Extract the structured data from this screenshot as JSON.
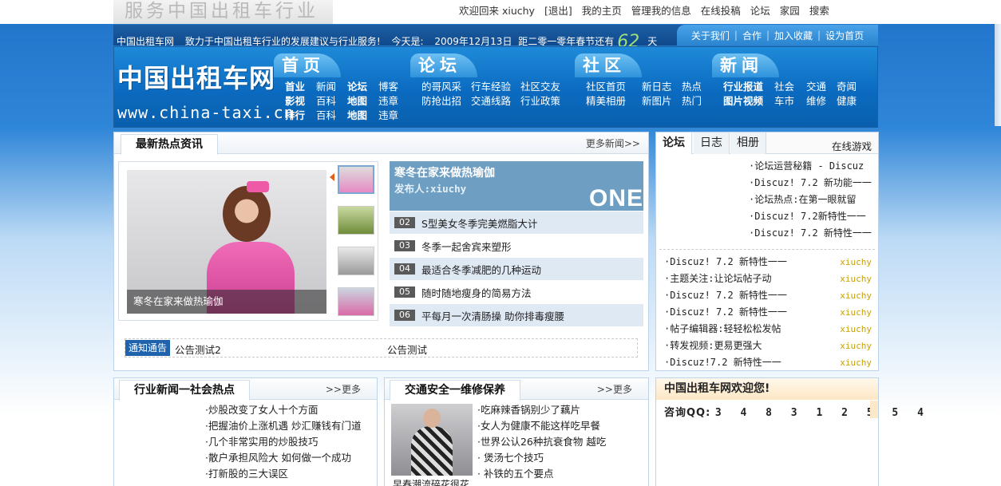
{
  "top": {
    "slogan": "服务中国出租车行业",
    "links": [
      "欢迎回来 xiuchy",
      "[退出]",
      "我的主页",
      "管理我的信息",
      "在线投稿",
      "论坛",
      "家园",
      "搜索"
    ]
  },
  "infobar": {
    "site": "中国出租车网",
    "motto": "致力于中国出租车行业的发展建议与行业服务!",
    "today_label": "今天是:",
    "date": "2009年12月13日",
    "countdown_prefix": "距二零一零年春节还有",
    "days": "62",
    "days_unit": "天",
    "links": [
      "关于我们",
      "合作",
      "加入收藏",
      "设为首页"
    ]
  },
  "logo": {
    "cn": "中国出租车网",
    "en": "www.china-taxi.cn"
  },
  "nav": [
    {
      "title": "首页",
      "rows": [
        [
          "首业",
          "新闻",
          "论坛",
          "博客"
        ],
        [
          "影视",
          "百科",
          "地图",
          "违章"
        ],
        [
          "排行",
          "百科",
          "地图",
          "违章"
        ]
      ]
    },
    {
      "title": "论坛",
      "rows": [
        [
          "的哥风采",
          "行车经验",
          "社区交友"
        ],
        [
          "防抢出招",
          "交通线路",
          "行业政策"
        ]
      ]
    },
    {
      "title": "社区",
      "rows": [
        [
          "社区首页",
          "新日志",
          "热点"
        ],
        [
          "精美相册",
          "新图片",
          "热门"
        ]
      ]
    },
    {
      "title": "新闻",
      "rows": [
        [
          "行业报道",
          "社会",
          "交通",
          "奇闻"
        ],
        [
          "图片视频",
          "车市",
          "维修",
          "健康"
        ]
      ]
    }
  ],
  "hot": {
    "title": "最新热点资讯",
    "more": "更多新闻>>",
    "slide_caption": "寒冬在家来做热瑜伽",
    "feature_title": "寒冬在家来做热瑜伽",
    "feature_author": "发布人:xiuchy",
    "feature_badge": "ONE",
    "items": [
      {
        "num": "02",
        "text": "S型美女冬季完美燃脂大计"
      },
      {
        "num": "03",
        "text": "冬季一起舍宾来塑形"
      },
      {
        "num": "04",
        "text": "最适合冬季减肥的几种运动"
      },
      {
        "num": "05",
        "text": "随时随地瘦身的简易方法"
      },
      {
        "num": "06",
        "text": "平每月一次清肠操 助你排毒瘦腰"
      }
    ],
    "notice_tag": "通知通告",
    "notices": [
      "公告测试2",
      "公告测试"
    ]
  },
  "forum": {
    "tabs": [
      "论坛",
      "日志",
      "相册"
    ],
    "game": "在线游戏",
    "list1": [
      "·论坛运营秘籍 - Discuz",
      "·Discuz! 7.2 新功能一一",
      "·论坛热点:在第一眼就留",
      "·Discuz! 7.2新特性一一",
      "·Discuz! 7.2 新特性一一"
    ],
    "list2": [
      {
        "text": "·Discuz! 7.2 新特性一一",
        "author": "xiuchy"
      },
      {
        "text": "·主题关注:让论坛帖子动",
        "author": "xiuchy"
      },
      {
        "text": "·Discuz! 7.2 新特性一一",
        "author": "xiuchy"
      },
      {
        "text": "·Discuz! 7.2 新特性一一",
        "author": "xiuchy"
      },
      {
        "text": "·帖子编辑器:轻轻松松发帖",
        "author": "xiuchy"
      },
      {
        "text": "·转发视频:更易更强大",
        "author": "xiuchy"
      },
      {
        "text": "·Discuz!7.2 新特性一一",
        "author": "xiuchy"
      }
    ]
  },
  "industry": {
    "title": "行业新闻一社会热点",
    "more": ">>更多",
    "items": [
      "·炒股改变了女人十个方面",
      "·把握油价上涨机遇 炒汇赚钱有门道",
      "·几个非常实用的炒股技巧",
      "·散户承担风险大 如何做一个成功",
      "·打新股的三大误区"
    ]
  },
  "traffic": {
    "title": "交通安全一维修保养",
    "more": ">>更多",
    "caption": "早春潮流碎花很花",
    "items": [
      "·吃麻辣香锅别少了藕片",
      "·女人为健康不能这样吃早餐",
      "·世界公认26种抗衰食物 越吃",
      "· 煲汤七个技巧",
      "· 补铁的五个要点"
    ]
  },
  "welcome": {
    "title": "中国出租车网欢迎您!",
    "qq_label": "咨询QQ:",
    "qq_number": "3 4 8 3 1 2 5 5 4"
  }
}
